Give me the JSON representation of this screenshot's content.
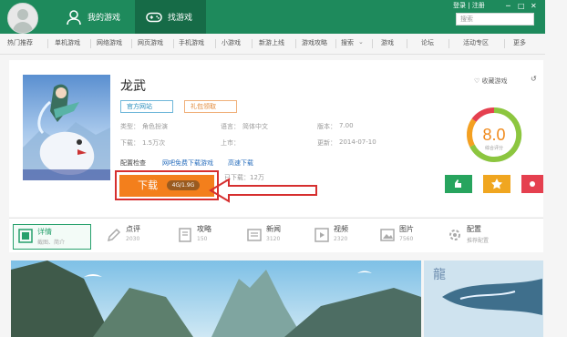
{
  "header": {
    "tabs": [
      {
        "label": "我的游戏",
        "icon": "user-icon"
      },
      {
        "label": "找游戏",
        "icon": "gamepad-icon"
      }
    ],
    "search_placeholder": "搜索",
    "user_link": "登录 | 注册",
    "window_controls": [
      "─",
      "□",
      "✕"
    ]
  },
  "categories": [
    "热门推荐",
    "单机游戏",
    "网络游戏",
    "网页游戏",
    "手机游戏",
    "小游戏",
    "新游上线",
    "游戏攻略",
    "搜索",
    "游戏",
    "论坛",
    "活动专区",
    "更多"
  ],
  "game": {
    "title": "龙武",
    "badges": [
      "官方网站",
      "礼包领取"
    ],
    "info": [
      {
        "k": "类型：",
        "v": "角色扮演"
      },
      {
        "k": "语言：",
        "v": "简体中文"
      },
      {
        "k": "版本：",
        "v": "7.00"
      },
      {
        "k": "下载：",
        "v": "1.5万次"
      },
      {
        "k": "上市：",
        "v": ""
      },
      {
        "k": "更新：",
        "v": "2014-07-10"
      }
    ],
    "links": [
      "配置检查",
      "网吧免费下载游戏",
      "高速下载"
    ],
    "download": {
      "label": "下载",
      "size": "4G/1.9G",
      "note": "已下载：12万"
    },
    "favorite": "♡ 收藏游戏",
    "share": "↺",
    "score": "8.0",
    "score_label": "综合评分",
    "actions": [
      {
        "color": "#27a45e",
        "icon": "thumb-up-icon"
      },
      {
        "color": "#f0a620",
        "icon": "star-icon"
      },
      {
        "color": "#e5404f",
        "icon": "share-icon"
      }
    ]
  },
  "subtabs": [
    {
      "label": "详情",
      "sub": "截图、简介",
      "icon": "detail-icon"
    },
    {
      "label": "点评",
      "sub": "2030",
      "icon": "edit-icon"
    },
    {
      "label": "攻略",
      "sub": "150",
      "icon": "book-icon"
    },
    {
      "label": "新闻",
      "sub": "3120",
      "icon": "news-icon"
    },
    {
      "label": "视频",
      "sub": "2320",
      "icon": "video-icon"
    },
    {
      "label": "图片",
      "sub": "7560",
      "icon": "image-icon"
    },
    {
      "label": "配置",
      "sub": "推荐配置",
      "icon": "gear-icon"
    }
  ]
}
